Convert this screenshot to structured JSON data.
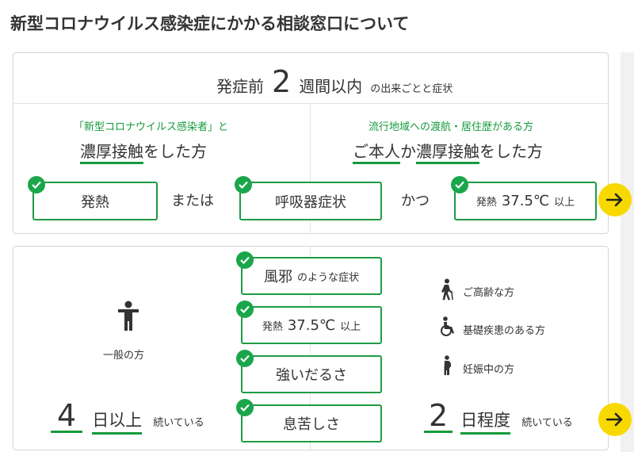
{
  "page_title": "新型コロナウイルス感染症にかかる相談窓口について",
  "top": {
    "head_pre": "発症前",
    "head_num": "2",
    "head_unit": "週間以内",
    "head_tail": "の出来ごとと症状",
    "left_caption": "「新型コロナウイルス感染者」と",
    "left_main_u": "濃厚接触",
    "left_main_rest": "をした方",
    "right_caption": "流行地域への渡航・居住歴がある方",
    "right_main_u1": "ご本人",
    "right_main_mid": "か",
    "right_main_u2": "濃厚接触",
    "right_main_rest": "をした方",
    "box_fever": "発熱",
    "or": "または",
    "box_resp": "呼吸器症状",
    "and": "かつ",
    "box_temp_pre": "発熱",
    "box_temp_val": "37.5℃",
    "box_temp_post": "以上"
  },
  "bottom": {
    "general_label": "一般の方",
    "left_num": "4",
    "left_unit": "日以上",
    "left_tail": "続いている",
    "sym1_main": "風邪",
    "sym1_tail": "のような症状",
    "sym2_pre": "発熱",
    "sym2_val": "37.5℃",
    "sym2_post": "以上",
    "sym3": "強いだるさ",
    "sym4": "息苦しさ",
    "elderly": "ご高齢な方",
    "disease": "基礎疾患のある方",
    "pregnant": "妊娠中の方",
    "right_num": "2",
    "right_unit": "日程度",
    "right_tail": "続いている"
  },
  "colors": {
    "accent_green": "#149b3c",
    "arrow_yellow": "#f7d900",
    "text": "#333333"
  },
  "icons": [
    "check-icon",
    "arrow-right-icon",
    "person-icon",
    "walking-elderly-icon",
    "wheelchair-icon",
    "pregnant-icon"
  ]
}
